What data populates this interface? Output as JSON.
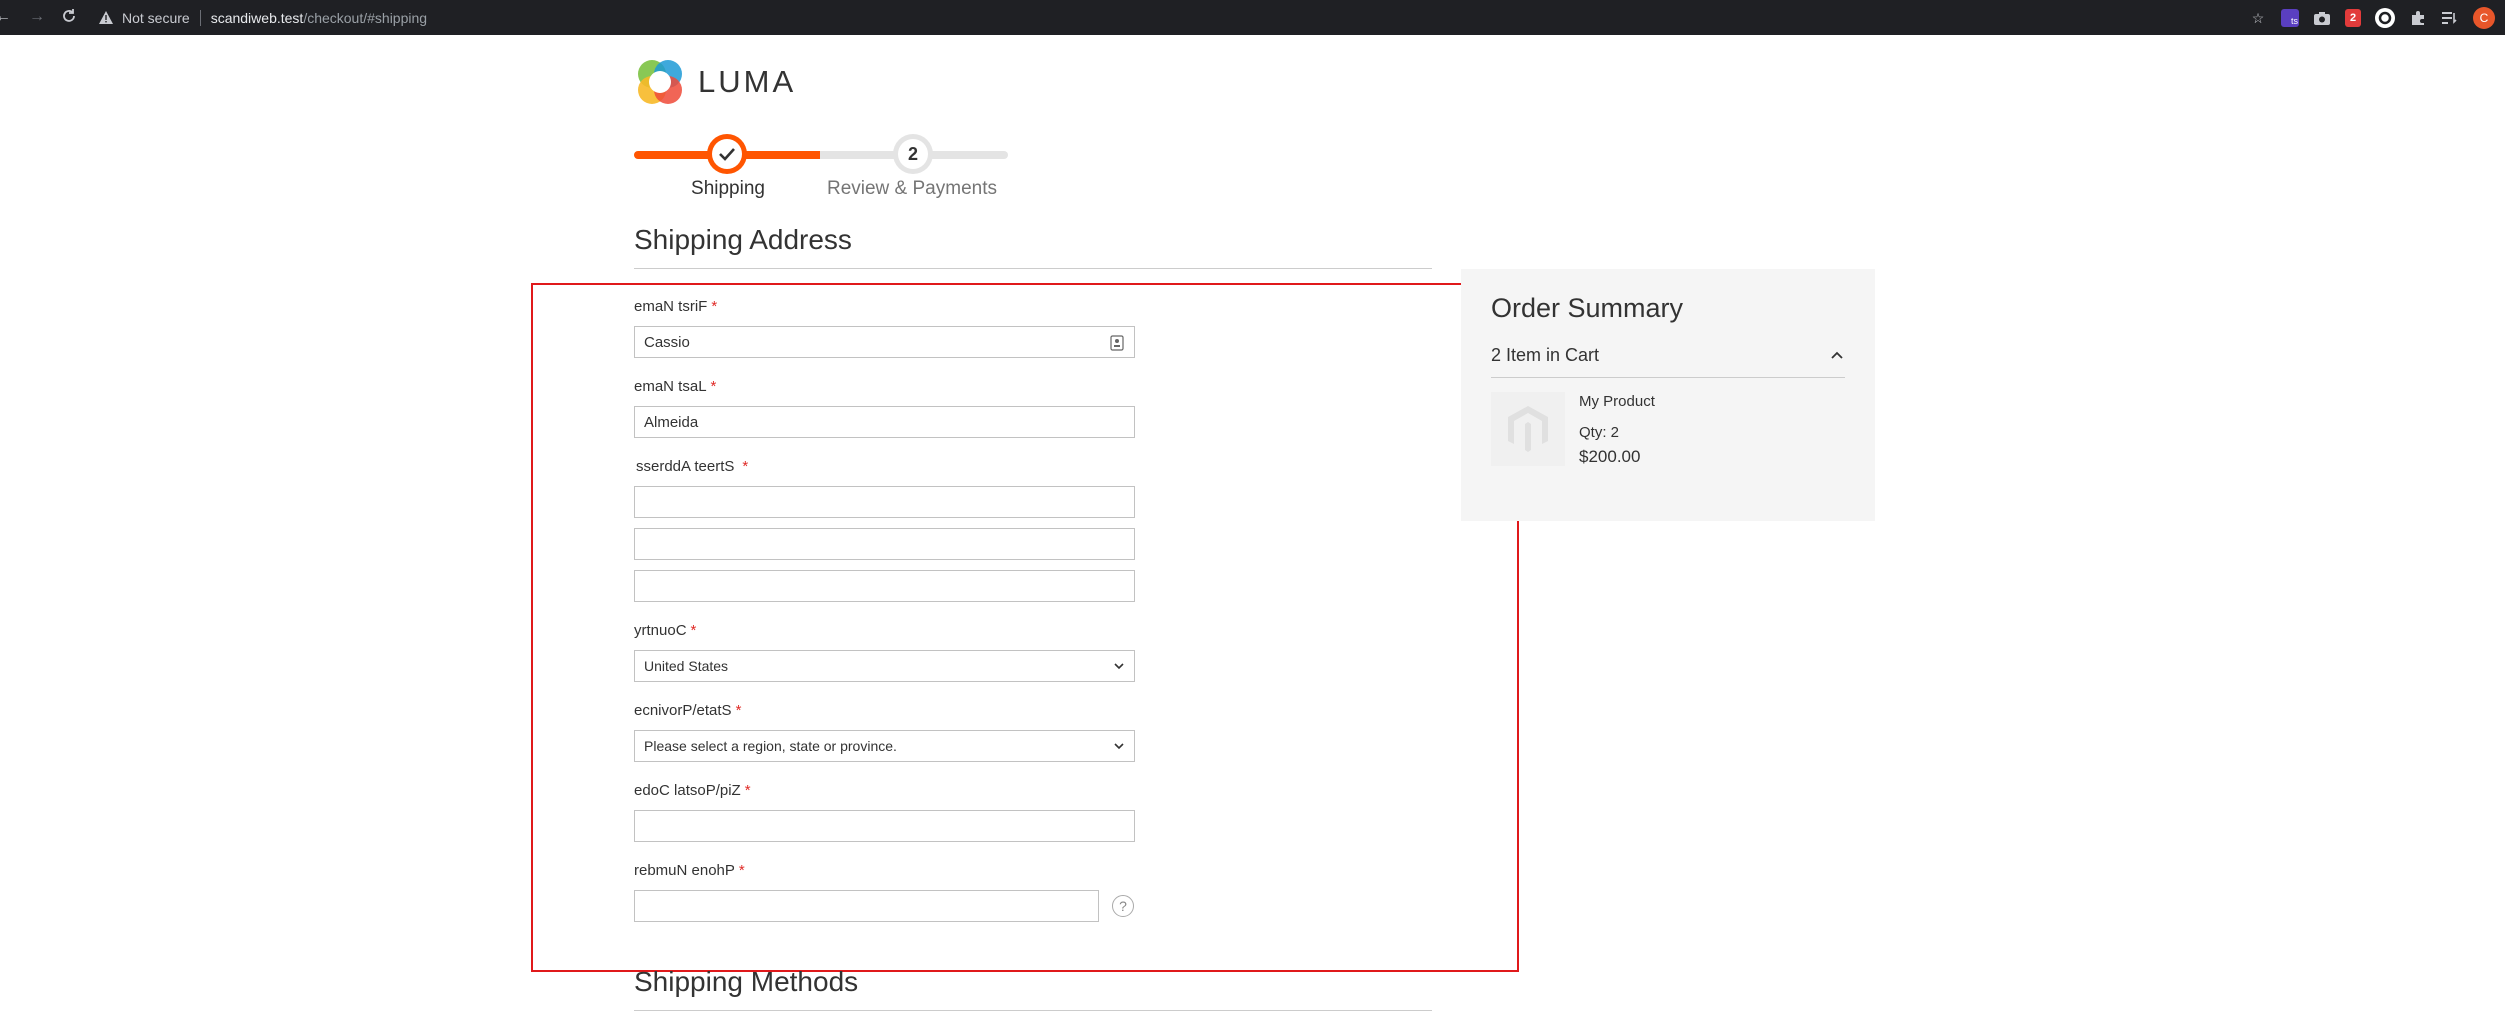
{
  "browser": {
    "security_label": "Not secure",
    "url_host": "scandiweb.test",
    "url_path": "/checkout/#shipping",
    "profile_initial": "C",
    "extension_badge_ts": "ts",
    "extension_badge_count": "2"
  },
  "brand": {
    "logo_text": "LUMA"
  },
  "progress": {
    "steps": [
      {
        "label": "Shipping",
        "state": "active"
      },
      {
        "label": "Review & Payments",
        "number": "2",
        "state": "pending"
      }
    ],
    "accent_color": "#ff5501"
  },
  "shipping_address": {
    "title": "Shipping Address",
    "fields": {
      "first_name": {
        "label": "emaN tsriF",
        "value": "Cassio"
      },
      "last_name": {
        "label": "emaN tsaL",
        "value": "Almeida"
      },
      "street": {
        "label": "sserddA teertS",
        "lines": [
          "",
          "",
          ""
        ]
      },
      "country": {
        "label": "yrtnuoC",
        "value": "United States"
      },
      "state": {
        "label": "ecnivorP/etatS",
        "value": "Please select a region, state or province."
      },
      "zip": {
        "label": "edoC latsoP/piZ",
        "value": ""
      },
      "phone": {
        "label": "rebmuN enohP",
        "value": ""
      }
    },
    "required_marker": "*",
    "help_glyph": "?"
  },
  "shipping_methods": {
    "title": "Shipping Methods"
  },
  "order_summary": {
    "title": "Order Summary",
    "items_count_label": "2 Item in Cart",
    "product": {
      "name": "My Product",
      "qty": "Qty: 2",
      "price": "$200.00"
    }
  },
  "colors": {
    "required": "#e02b27",
    "highlight_box": "#e0191b"
  }
}
